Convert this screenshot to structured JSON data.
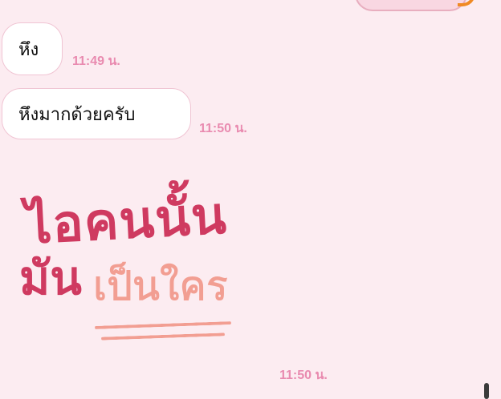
{
  "messages": [
    {
      "direction": "outgoing",
      "text": "",
      "time": ""
    },
    {
      "direction": "incoming",
      "text": "หึง",
      "time": "11:49 น."
    },
    {
      "direction": "incoming",
      "text": "หึงมากด้วยครับ",
      "time": "11:50 น."
    },
    {
      "direction": "incoming",
      "type": "sticker",
      "sticker_text": {
        "line1": "ไอคนนั้น",
        "line2a": "มัน",
        "line2b": "เป็นใคร"
      },
      "time": "11:50 น."
    }
  ],
  "colors": {
    "background": "#fcecf1",
    "time_text": "#e98bb0",
    "incoming_bubble": "#ffffff",
    "sticker_primary": "#cf3a60",
    "sticker_secondary": "#f29e92"
  }
}
